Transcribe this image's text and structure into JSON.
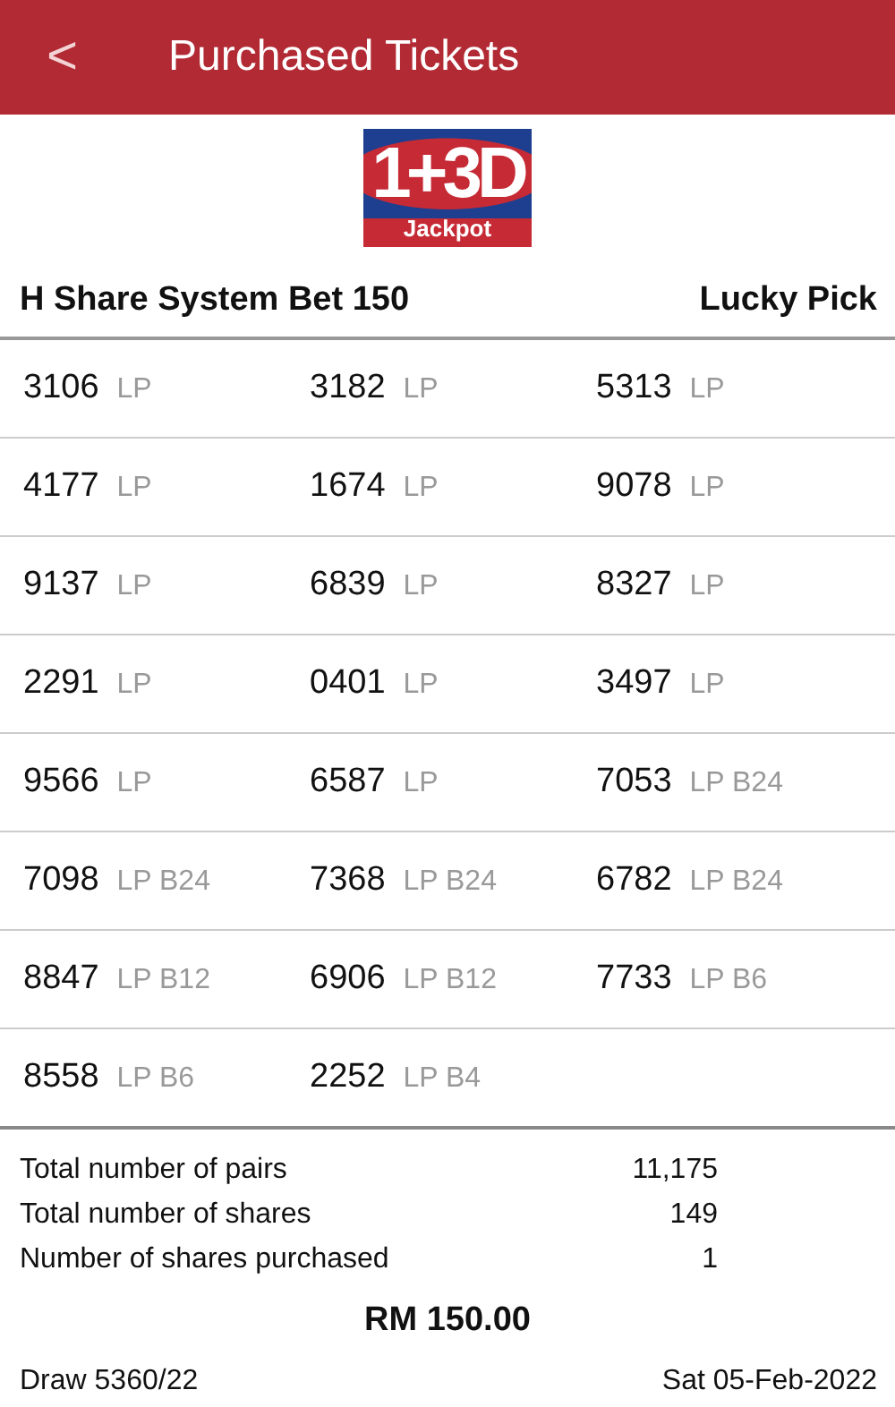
{
  "header": {
    "back": "<",
    "title": "Purchased Tickets"
  },
  "logo": {
    "main": "1+3D",
    "sub": "Jackpot"
  },
  "bet": {
    "type": "H Share System Bet 150",
    "mode": "Lucky Pick"
  },
  "ticket_rows": [
    [
      {
        "number": "3106",
        "tag": "LP"
      },
      {
        "number": "3182",
        "tag": "LP"
      },
      {
        "number": "5313",
        "tag": "LP"
      }
    ],
    [
      {
        "number": "4177",
        "tag": "LP"
      },
      {
        "number": "1674",
        "tag": "LP"
      },
      {
        "number": "9078",
        "tag": "LP"
      }
    ],
    [
      {
        "number": "9137",
        "tag": "LP"
      },
      {
        "number": "6839",
        "tag": "LP"
      },
      {
        "number": "8327",
        "tag": "LP"
      }
    ],
    [
      {
        "number": "2291",
        "tag": "LP"
      },
      {
        "number": "0401",
        "tag": "LP"
      },
      {
        "number": "3497",
        "tag": "LP"
      }
    ],
    [
      {
        "number": "9566",
        "tag": "LP"
      },
      {
        "number": "6587",
        "tag": "LP"
      },
      {
        "number": "7053",
        "tag": "LP B24"
      }
    ],
    [
      {
        "number": "7098",
        "tag": "LP B24"
      },
      {
        "number": "7368",
        "tag": "LP B24"
      },
      {
        "number": "6782",
        "tag": "LP B24"
      }
    ],
    [
      {
        "number": "8847",
        "tag": "LP B12"
      },
      {
        "number": "6906",
        "tag": "LP B12"
      },
      {
        "number": "7733",
        "tag": "LP B6"
      }
    ],
    [
      {
        "number": "8558",
        "tag": "LP B6"
      },
      {
        "number": "2252",
        "tag": "LP B4"
      }
    ]
  ],
  "summary": [
    {
      "label": "Total number of pairs",
      "value": "11,175"
    },
    {
      "label": "Total number of shares",
      "value": "149"
    },
    {
      "label": "Number of shares purchased",
      "value": "1"
    }
  ],
  "total": "RM 150.00",
  "footer": {
    "draw": "Draw 5360/22",
    "date": "Sat 05-Feb-2022"
  }
}
